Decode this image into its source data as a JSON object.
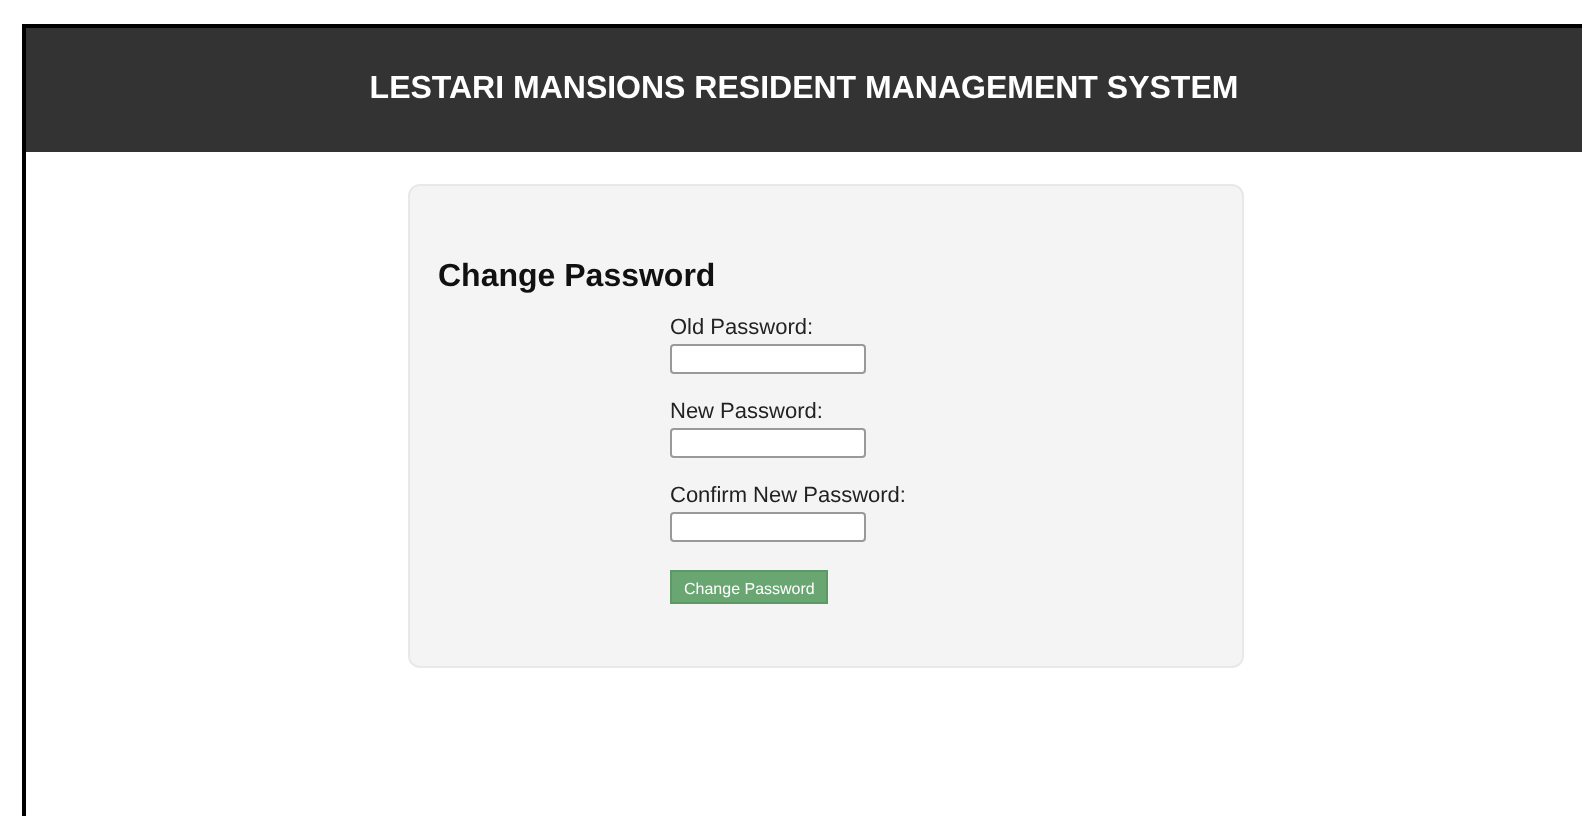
{
  "header": {
    "title": "LESTARI MANSIONS RESIDENT MANAGEMENT SYSTEM"
  },
  "form": {
    "title": "Change Password",
    "fields": [
      {
        "label": "Old Password:"
      },
      {
        "label": "New Password:"
      },
      {
        "label": "Confirm New Password:"
      }
    ],
    "submit": "Change Password"
  }
}
